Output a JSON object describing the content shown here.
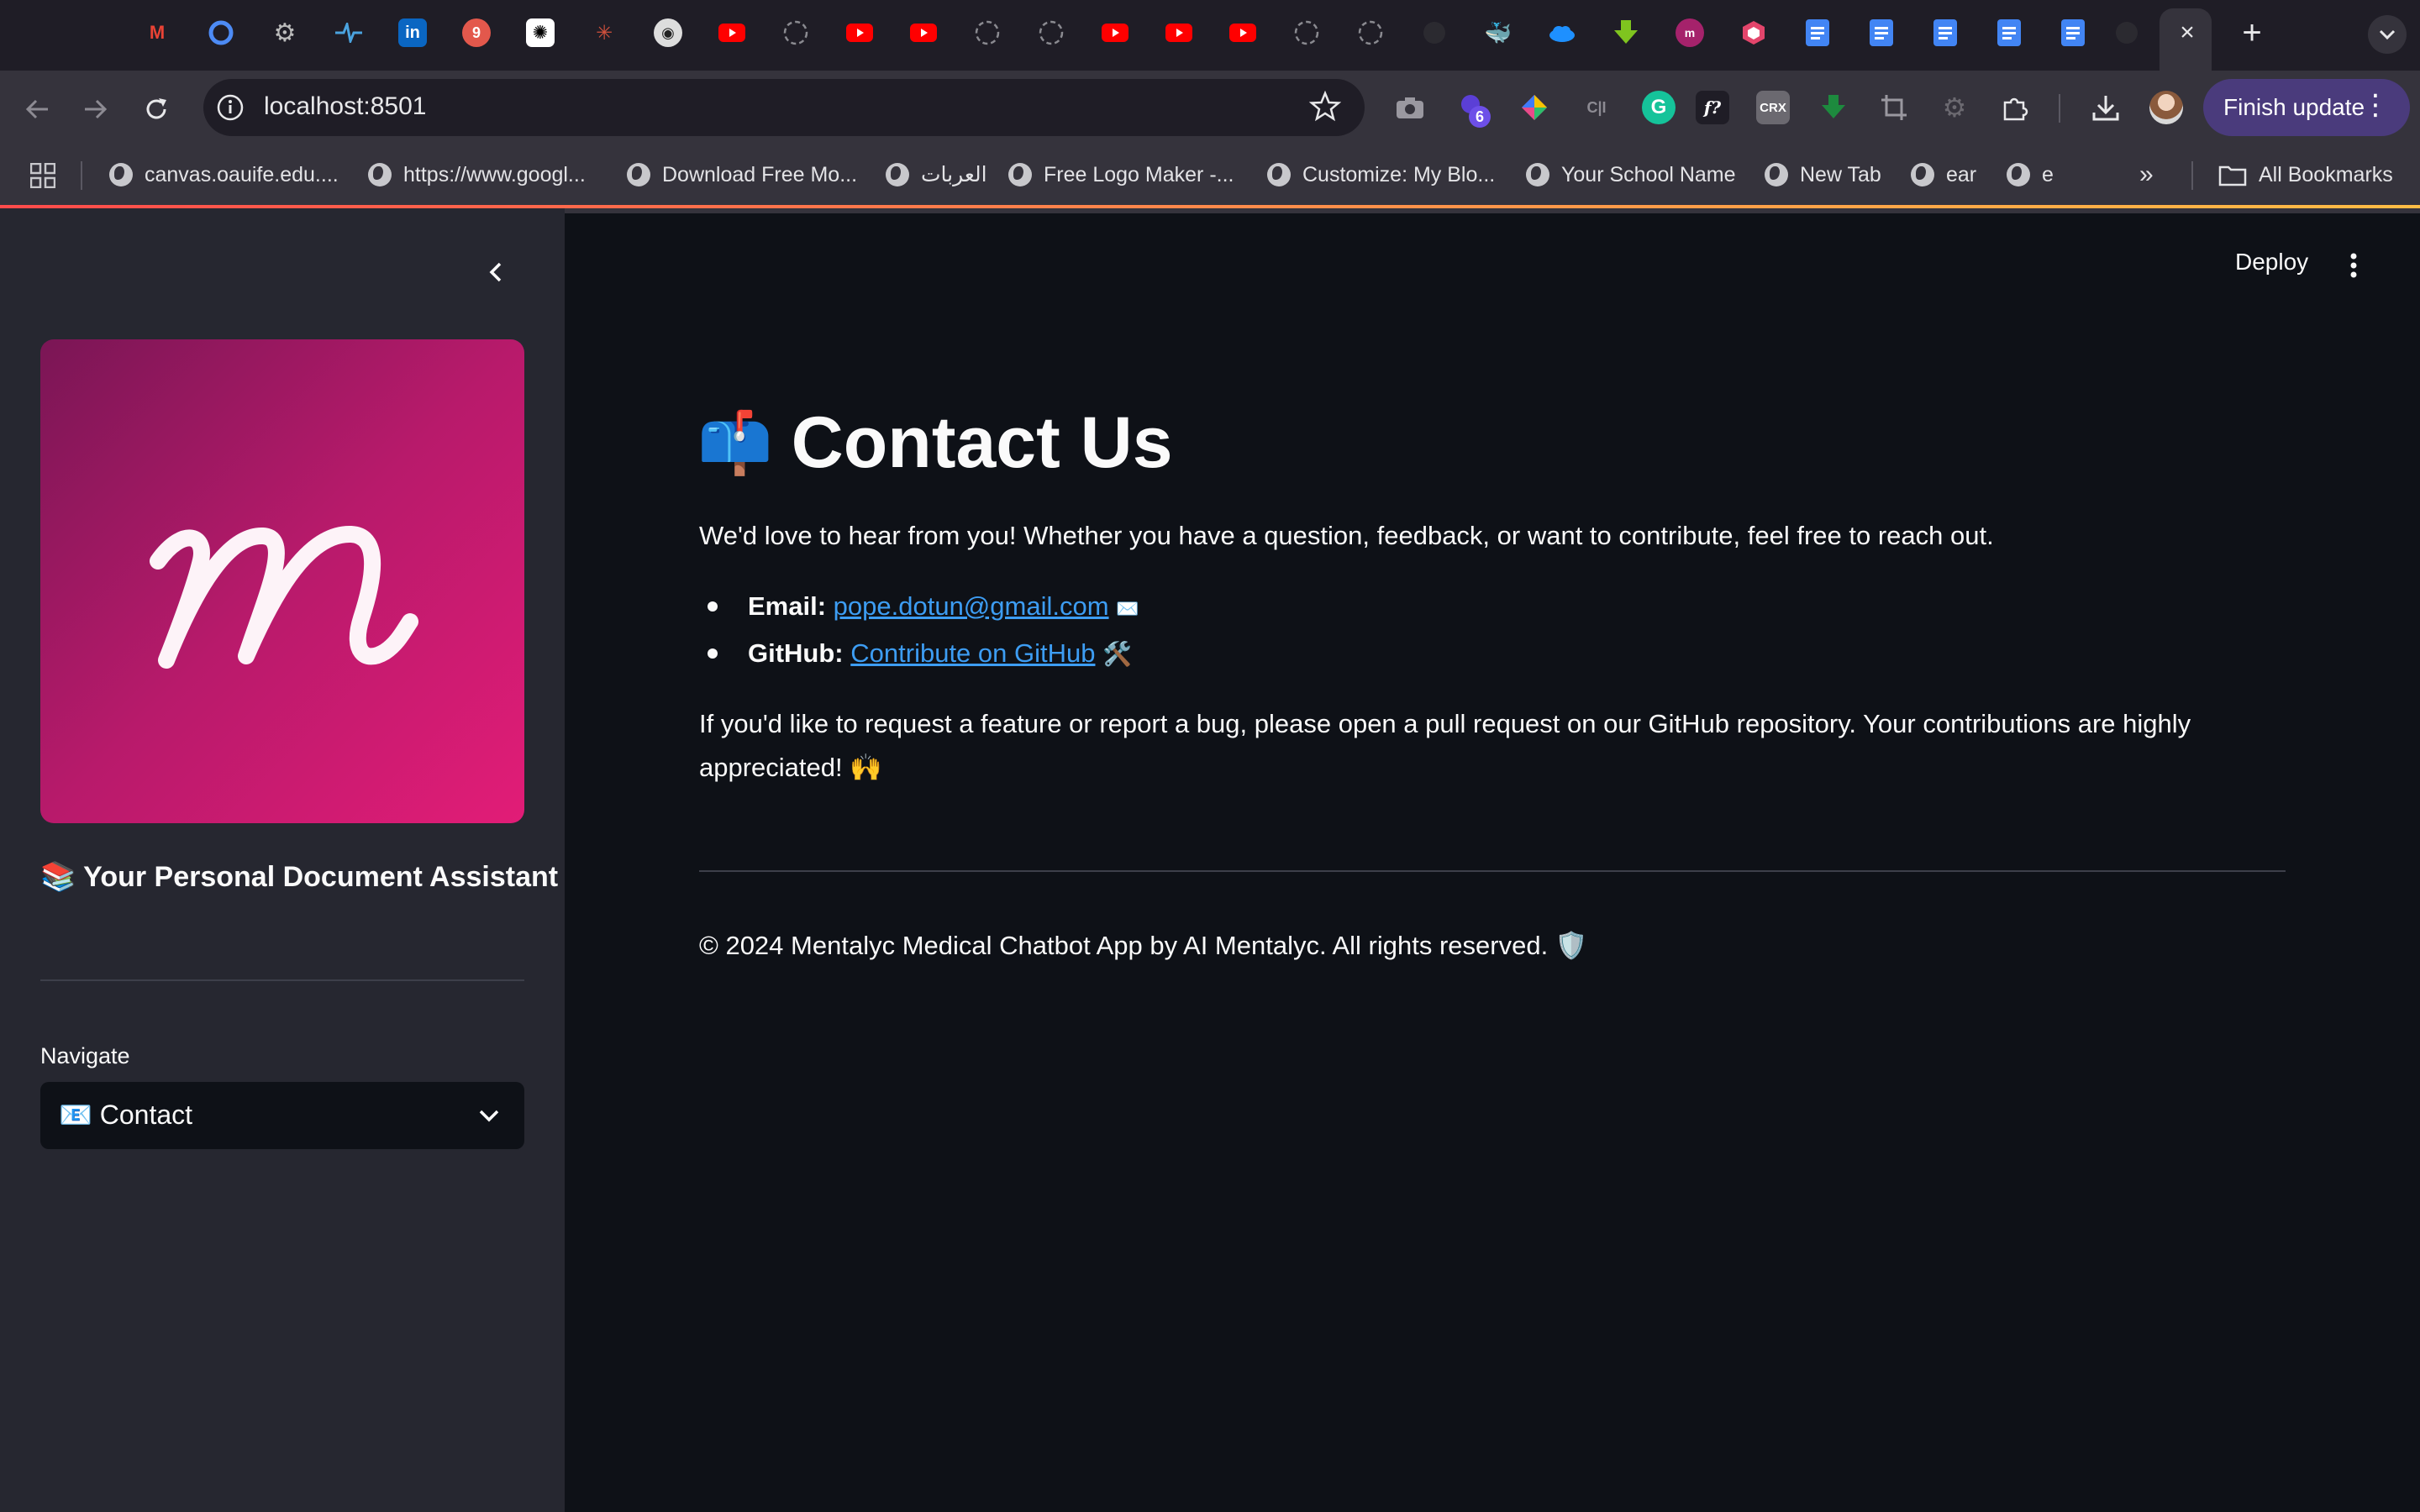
{
  "browser": {
    "url": "localhost:8501",
    "finish_update_label": "Finish update",
    "extension_badge": "6",
    "tab_favicons": [
      "gmail-icon",
      "chromium-icon",
      "settings-icon",
      "pulse-icon",
      "linkedin-icon",
      "app-icon",
      "openai-icon",
      "spark-icon",
      "owl-icon",
      "youtube-icon",
      "loading-icon",
      "youtube-icon",
      "youtube-icon",
      "loading-icon",
      "loading-icon",
      "youtube-icon",
      "youtube-icon",
      "youtube-icon",
      "loading-icon",
      "loading-icon",
      "github-icon",
      "docker-icon",
      "cloud-icon",
      "download-icon",
      "app-icon",
      "shield-icon",
      "docs-icon",
      "docs-icon",
      "docs-icon",
      "docs-icon",
      "docs-icon",
      "github-icon"
    ],
    "bookmarks": [
      {
        "label": "canvas.oauife.edu...."
      },
      {
        "label": "https://www.googl..."
      },
      {
        "label": "Download Free Mo..."
      },
      {
        "label": "العربات"
      },
      {
        "label": "Free Logo Maker -..."
      },
      {
        "label": "Customize: My Blo..."
      },
      {
        "label": "Your School Name"
      },
      {
        "label": "New Tab"
      },
      {
        "label": "ear"
      },
      {
        "label": "e"
      }
    ],
    "all_bookmarks_label": "All Bookmarks"
  },
  "sidebar": {
    "logo_letter": "m",
    "title": "📚 Your Personal Document Assistant",
    "navigate_label": "Navigate",
    "selected_page": "📧 Contact"
  },
  "header": {
    "deploy_label": "Deploy"
  },
  "main": {
    "title_emoji": "📫",
    "title": "Contact Us",
    "intro": "We'd love to hear from you! Whether you have a question, feedback, or want to contribute, feel free to reach out.",
    "email_label": "Email:",
    "email_link": "pope.dotun@gmail.com",
    "email_suffix": "✉️",
    "github_label": "GitHub:",
    "github_link": "Contribute on GitHub",
    "github_suffix": "🛠️",
    "request_line1": "If you'd like to request a feature or report a bug, please open a pull request on our GitHub repository. Your contributions are highly",
    "request_line2": "appreciated! 🙌",
    "footer": "© 2024 Mentalyc Medical Chatbot App by AI Mentalyc. All rights reserved. 🛡️"
  },
  "colors": {
    "app_background": "#0e1117",
    "sidebar_background": "#262730",
    "link": "#3d9df3",
    "logo_gradient_start": "#7a1655",
    "logo_gradient_end": "#e21c77",
    "finish_update": "#4a3b7c"
  }
}
